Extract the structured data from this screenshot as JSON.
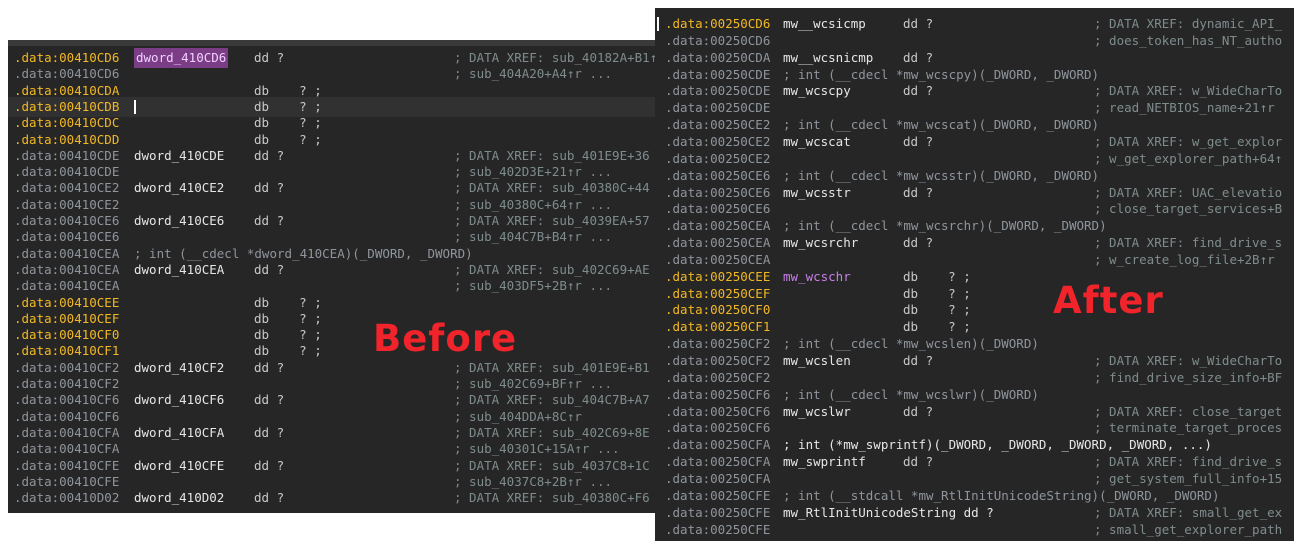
{
  "before": {
    "label": "Before",
    "lines": [
      {
        "a": ".data:00410CD6",
        "n": "dword_410CD6",
        "d": "dd ?",
        "c": "; DATA XREF: sub_40182A+B1↑",
        "addrColor": "y",
        "nameStyle": "sel"
      },
      {
        "a": ".data:00410CD6",
        "n": "",
        "d": "",
        "c": "; sub_404A20+A4↑r ..."
      },
      {
        "a": ".data:00410CDA",
        "n": "",
        "d": "db    ? ;",
        "c": "",
        "addrColor": "y"
      },
      {
        "a": ".data:00410CDB",
        "n": "",
        "d": "db    ? ;",
        "c": "",
        "addrColor": "y",
        "cursor": true,
        "hl": true
      },
      {
        "a": ".data:00410CDC",
        "n": "",
        "d": "db    ? ;",
        "c": "",
        "addrColor": "y"
      },
      {
        "a": ".data:00410CDD",
        "n": "",
        "d": "db    ? ;",
        "c": "",
        "addrColor": "y"
      },
      {
        "a": ".data:00410CDE",
        "n": "dword_410CDE",
        "d": "dd ?",
        "c": "; DATA XREF: sub_401E9E+36"
      },
      {
        "a": ".data:00410CDE",
        "n": "",
        "d": "",
        "c": "; sub_402D3E+21↑r ..."
      },
      {
        "a": ".data:00410CE2",
        "n": "dword_410CE2",
        "d": "dd ?",
        "c": "; DATA XREF: sub_40380C+44"
      },
      {
        "a": ".data:00410CE2",
        "n": "",
        "d": "",
        "c": "; sub_40380C+64↑r ..."
      },
      {
        "a": ".data:00410CE6",
        "n": "dword_410CE6",
        "d": "dd ?",
        "c": "; DATA XREF: sub_4039EA+57"
      },
      {
        "a": ".data:00410CE6",
        "n": "",
        "d": "",
        "c": "; sub_404C7B+B4↑r ..."
      },
      {
        "a": ".data:00410CEA",
        "n": "; int (__cdecl *dword_410CEA)(_DWORD, _DWORD)",
        "d": "",
        "c": "",
        "nameStyle": "proto"
      },
      {
        "a": ".data:00410CEA",
        "n": "dword_410CEA",
        "d": "dd ?",
        "c": "; DATA XREF: sub_402C69+AE"
      },
      {
        "a": ".data:00410CEA",
        "n": "",
        "d": "",
        "c": "; sub_403DF5+2B↑r ..."
      },
      {
        "a": ".data:00410CEE",
        "n": "",
        "d": "db    ? ;",
        "c": "",
        "addrColor": "y"
      },
      {
        "a": ".data:00410CEF",
        "n": "",
        "d": "db    ? ;",
        "c": "",
        "addrColor": "y"
      },
      {
        "a": ".data:00410CF0",
        "n": "",
        "d": "db    ? ;",
        "c": "",
        "addrColor": "y"
      },
      {
        "a": ".data:00410CF1",
        "n": "",
        "d": "db    ? ;",
        "c": "",
        "addrColor": "y"
      },
      {
        "a": ".data:00410CF2",
        "n": "dword_410CF2",
        "d": "dd ?",
        "c": "; DATA XREF: sub_401E9E+B1"
      },
      {
        "a": ".data:00410CF2",
        "n": "",
        "d": "",
        "c": "; sub_402C69+BF↑r ..."
      },
      {
        "a": ".data:00410CF6",
        "n": "dword_410CF6",
        "d": "dd ?",
        "c": "; DATA XREF: sub_404C7B+A7"
      },
      {
        "a": ".data:00410CF6",
        "n": "",
        "d": "",
        "c": "; sub_404DDA+8C↑r"
      },
      {
        "a": ".data:00410CFA",
        "n": "dword_410CFA",
        "d": "dd ?",
        "c": "; DATA XREF: sub_402C69+8E"
      },
      {
        "a": ".data:00410CFA",
        "n": "",
        "d": "",
        "c": "; sub_40301C+15A↑r ..."
      },
      {
        "a": ".data:00410CFE",
        "n": "dword_410CFE",
        "d": "dd ?",
        "c": "; DATA XREF: sub_4037C8+1C"
      },
      {
        "a": ".data:00410CFE",
        "n": "",
        "d": "",
        "c": "; sub_4037C8+2B↑r ..."
      },
      {
        "a": ".data:00410D02",
        "n": "dword_410D02",
        "d": "dd ?",
        "c": "; DATA XREF: sub_40380C+F6"
      }
    ]
  },
  "after": {
    "label": "After",
    "lines": [
      {
        "a": ".data:00250CD6",
        "n": "mw__wcsicmp",
        "d": "dd ?",
        "c": "; DATA XREF: dynamic_API_",
        "addrColor": "y",
        "cursor": true
      },
      {
        "a": ".data:00250CD6",
        "n": "",
        "d": "",
        "c": "; does_token_has_NT_autho"
      },
      {
        "a": ".data:00250CDA",
        "n": "mw__wcsnicmp",
        "d": "dd ?",
        "c": ""
      },
      {
        "a": ".data:00250CDE",
        "n": "; int (__cdecl *mw_wcscpy)(_DWORD, _DWORD)",
        "d": "",
        "c": "",
        "nameStyle": "proto"
      },
      {
        "a": ".data:00250CDE",
        "n": "mw_wcscpy",
        "d": "dd ?",
        "c": "; DATA XREF: w_WideCharTo"
      },
      {
        "a": ".data:00250CDE",
        "n": "",
        "d": "",
        "c": "; read_NETBIOS_name+21↑r"
      },
      {
        "a": ".data:00250CE2",
        "n": "; int (__cdecl *mw_wcscat)(_DWORD, _DWORD)",
        "d": "",
        "c": "",
        "nameStyle": "proto"
      },
      {
        "a": ".data:00250CE2",
        "n": "mw_wcscat",
        "d": "dd ?",
        "c": "; DATA XREF: w_get_explor"
      },
      {
        "a": ".data:00250CE2",
        "n": "",
        "d": "",
        "c": "; w_get_explorer_path+64↑"
      },
      {
        "a": ".data:00250CE6",
        "n": "; int (__cdecl *mw_wcsstr)(_DWORD, _DWORD)",
        "d": "",
        "c": "",
        "nameStyle": "proto"
      },
      {
        "a": ".data:00250CE6",
        "n": "mw_wcsstr",
        "d": "dd ?",
        "c": "; DATA XREF: UAC_elevatio"
      },
      {
        "a": ".data:00250CE6",
        "n": "",
        "d": "",
        "c": "; close_target_services+B"
      },
      {
        "a": ".data:00250CEA",
        "n": "; int (__cdecl *mw_wcsrchr)(_DWORD, _DWORD)",
        "d": "",
        "c": "",
        "nameStyle": "proto"
      },
      {
        "a": ".data:00250CEA",
        "n": "mw_wcsrchr",
        "d": "dd ?",
        "c": "; DATA XREF: find_drive_s"
      },
      {
        "a": ".data:00250CEA",
        "n": "",
        "d": "",
        "c": "; w_create_log_file+2B↑r"
      },
      {
        "a": ".data:00250CEE",
        "n": "mw_wcschr",
        "d": "db    ? ;",
        "c": "",
        "addrColor": "y",
        "nameStyle": "purple"
      },
      {
        "a": ".data:00250CEF",
        "n": "",
        "d": "db    ? ;",
        "c": "",
        "addrColor": "y"
      },
      {
        "a": ".data:00250CF0",
        "n": "",
        "d": "db    ? ;",
        "c": "",
        "addrColor": "y"
      },
      {
        "a": ".data:00250CF1",
        "n": "",
        "d": "db    ? ;",
        "c": "",
        "addrColor": "y"
      },
      {
        "a": ".data:00250CF2",
        "n": "; int (__cdecl *mw_wcslen)(_DWORD)",
        "d": "",
        "c": "",
        "nameStyle": "proto"
      },
      {
        "a": ".data:00250CF2",
        "n": "mw_wcslen",
        "d": "dd ?",
        "c": "; DATA XREF: w_WideCharTo"
      },
      {
        "a": ".data:00250CF2",
        "n": "",
        "d": "",
        "c": "; find_drive_size_info+BF"
      },
      {
        "a": ".data:00250CF6",
        "n": "; int (__cdecl *mw_wcslwr)(_DWORD)",
        "d": "",
        "c": "",
        "nameStyle": "proto"
      },
      {
        "a": ".data:00250CF6",
        "n": "mw_wcslwr",
        "d": "dd ?",
        "c": "; DATA XREF: close_target"
      },
      {
        "a": ".data:00250CF6",
        "n": "",
        "d": "",
        "c": "; terminate_target_proces"
      },
      {
        "a": ".data:00250CFA",
        "n": "; int (*mw_swprintf)(_DWORD, _DWORD, _DWORD, _DWORD, ...)",
        "d": "",
        "c": "",
        "nameStyle": "protoWhite"
      },
      {
        "a": ".data:00250CFA",
        "n": "mw_swprintf",
        "d": "dd ?",
        "c": "; DATA XREF: find_drive_s"
      },
      {
        "a": ".data:00250CFA",
        "n": "",
        "d": "",
        "c": "; get_system_full_info+15"
      },
      {
        "a": ".data:00250CFE",
        "n": "; int (__stdcall *mw_RtlInitUnicodeString)(_DWORD, _DWORD)",
        "d": "",
        "c": "",
        "nameStyle": "proto"
      },
      {
        "a": ".data:00250CFE",
        "n": "mw_RtlInitUnicodeString dd ?",
        "d": "",
        "c": "; DATA XREF: small_get_ex"
      },
      {
        "a": ".data:00250CFE",
        "n": "",
        "d": "",
        "c": "; small_get_explorer_path"
      }
    ]
  }
}
